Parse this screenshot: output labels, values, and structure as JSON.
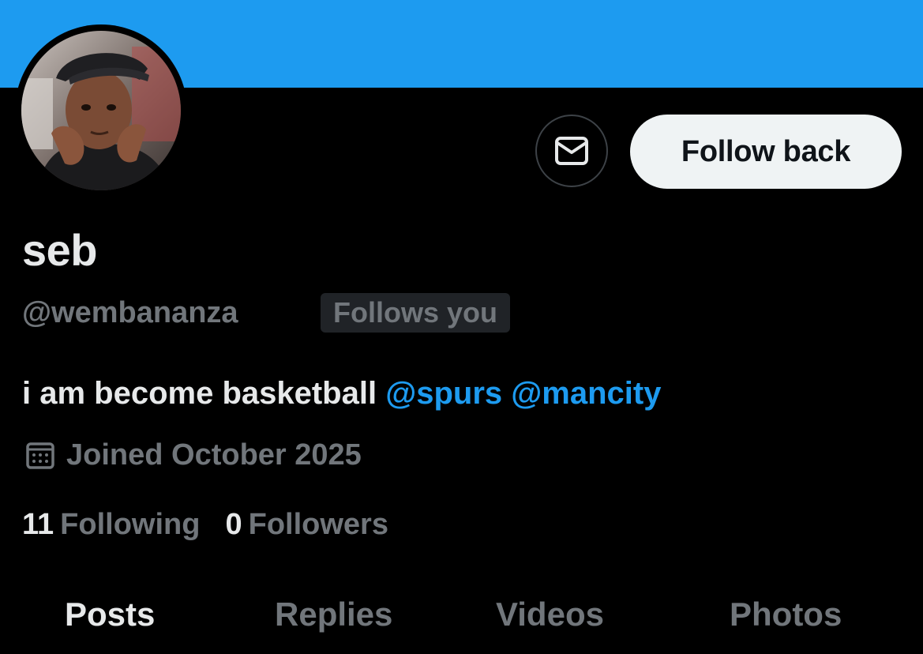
{
  "profile": {
    "display_name": "seb",
    "handle": "@wembananza",
    "follows_you_badge": "Follows you",
    "bio_text": "i am become basketball",
    "bio_mentions": [
      "@spurs",
      "@mancity"
    ],
    "joined": "Joined October 2025",
    "following_count": "11",
    "following_label": "Following",
    "followers_count": "0",
    "followers_label": "Followers"
  },
  "actions": {
    "follow_label": "Follow back",
    "message_icon": "envelope-icon"
  },
  "tabs": [
    {
      "label": "Posts",
      "active": true
    },
    {
      "label": "Replies",
      "active": false
    },
    {
      "label": "Videos",
      "active": false
    },
    {
      "label": "Photos",
      "active": false
    }
  ],
  "colors": {
    "banner": "#1d9bf0",
    "accent": "#1d9bf0",
    "background": "#000000",
    "primary_text": "#e7e9ea",
    "secondary_text": "#71767b"
  }
}
